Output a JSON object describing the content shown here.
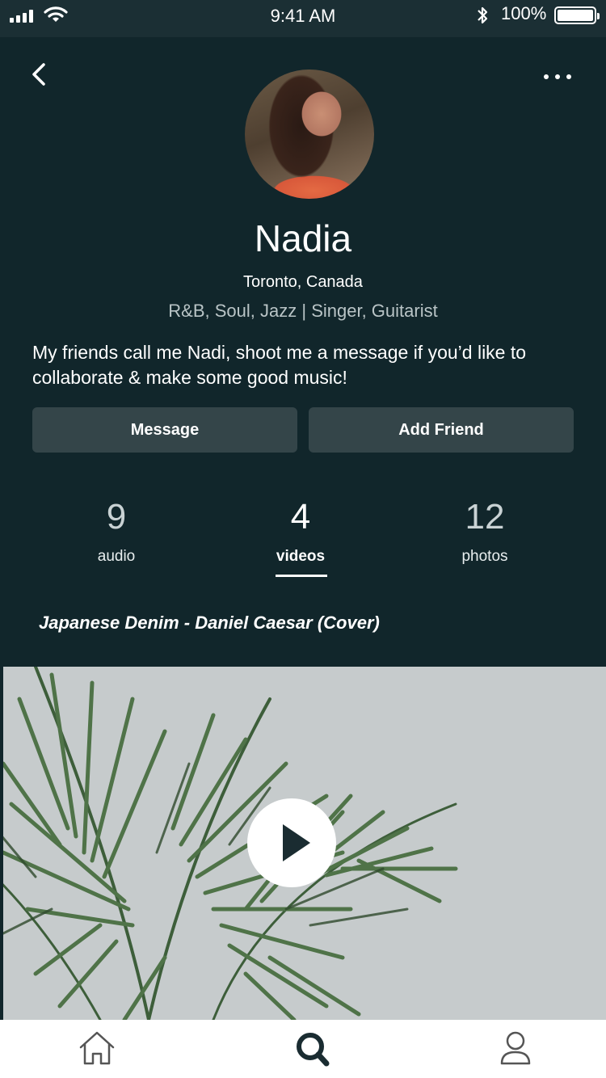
{
  "status_bar": {
    "time": "9:41 AM",
    "battery": "100%",
    "icons": [
      "signal-icon",
      "wifi-icon",
      "bluetooth-icon",
      "battery-icon"
    ]
  },
  "header": {
    "back_icon": "chevron-left-icon",
    "more_icon": "more-horizontal-icon"
  },
  "profile": {
    "name": "Nadia",
    "location": "Toronto, Canada",
    "genres": "R&B, Soul, Jazz | Singer, Guitarist",
    "bio": "My friends call me Nadi, shoot me a message if you’d like to collaborate & make some good music!"
  },
  "actions": {
    "message_label": "Message",
    "add_friend_label": "Add Friend"
  },
  "stats": [
    {
      "count": "9",
      "label": "audio"
    },
    {
      "count": "4",
      "label": "videos",
      "active": true
    },
    {
      "count": "12",
      "label": "photos"
    }
  ],
  "video": {
    "title": "Japanese Denim - Daniel Caesar (Cover)",
    "play_icon": "play-icon"
  },
  "tab_bar": {
    "items": [
      "home-icon",
      "search-icon",
      "user-icon"
    ],
    "active": "search-icon"
  },
  "colors": {
    "background": "#11262b",
    "status_bar": "#1b2f34",
    "button": "#344549",
    "text_muted": "#b9c4c6",
    "tab_bar": "#ffffff",
    "icon_dark": "#1a2c31"
  }
}
